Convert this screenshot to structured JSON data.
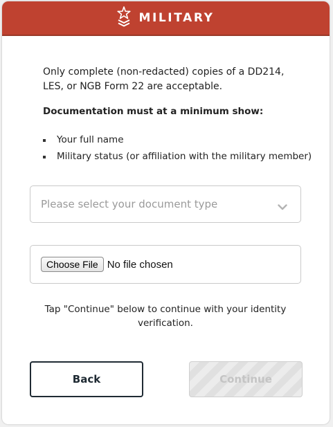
{
  "header": {
    "title": "MILITARY",
    "icon": "military-rank-star-icon",
    "color": "#bf4230"
  },
  "intro": "Only complete (non-redacted) copies of a DD214, LES, or NGB Form 22 are acceptable.",
  "requirements": {
    "title": "Documentation must at a minimum show:",
    "items": [
      "Your full name",
      "Military status (or affiliation with the military member)"
    ]
  },
  "document_type": {
    "placeholder": "Please select your document type"
  },
  "file_upload": {
    "button_label": "Choose File",
    "status": "No file chosen"
  },
  "instruction": "Tap \"Continue\" below to continue with your identity verification.",
  "buttons": {
    "back": "Back",
    "continue": "Continue"
  }
}
